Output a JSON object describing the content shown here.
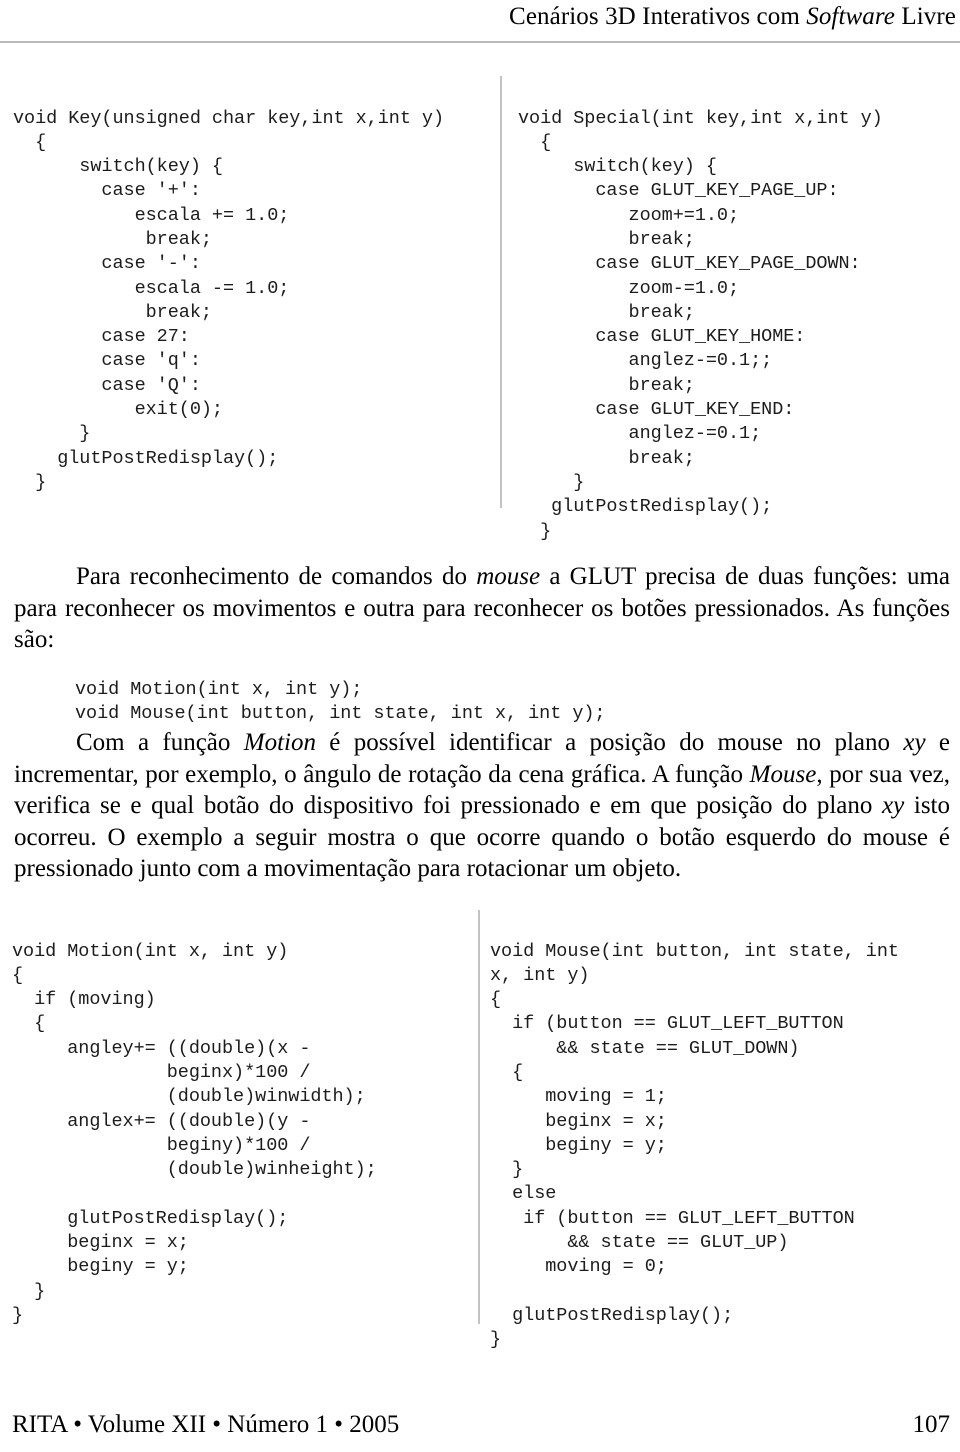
{
  "header": {
    "title_part1": "Cenários 3D Interativos com ",
    "title_italic": "Software",
    "title_part2": " Livre"
  },
  "code_block_key": "void Key(unsigned char key,int x,int y)\n  {\n      switch(key) {\n        case '+':\n           escala += 1.0;\n            break;\n        case '-':\n           escala -= 1.0;\n            break;\n        case 27:\n        case 'q':\n        case 'Q':\n           exit(0);\n      }\n    glutPostRedisplay();\n  }",
  "code_block_special": "void Special(int key,int x,int y)\n  {\n     switch(key) {\n       case GLUT_KEY_PAGE_UP:\n          zoom+=1.0;\n          break;\n       case GLUT_KEY_PAGE_DOWN:\n          zoom-=1.0;\n          break;\n       case GLUT_KEY_HOME:\n          anglez-=0.1;;\n          break;\n       case GLUT_KEY_END:\n          anglez-=0.1;\n          break;\n     }\n   glutPostRedisplay();\n  }",
  "paragraph_1": {
    "run1": "Para reconhecimento de comandos do ",
    "italic1": "mouse",
    "run2": " a GLUT precisa de duas funções: uma para reconhecer os movimentos e outra para reconhecer os botões pressionados. As funções são:"
  },
  "code_prototypes": "void Motion(int x, int y);\nvoid Mouse(int button, int state, int x, int y);",
  "paragraph_2": {
    "run1": "Com a função ",
    "italic1": "Motion",
    "run2": " é possível identificar a posição do mouse no plano ",
    "italic2": "xy",
    "run3": " e incrementar, por exemplo, o ângulo de rotação da cena gráfica. A função ",
    "italic3": "Mouse",
    "run4": ", por sua vez, verifica se e qual botão do dispositivo foi pressionado e em que posição do plano ",
    "italic4": "xy",
    "run5": " isto ocorreu. O exemplo a seguir mostra o que ocorre quando o botão esquerdo do mouse é pressionado junto com a movimentação para rotacionar um objeto."
  },
  "code_block_motion": "void Motion(int x, int y)\n{\n  if (moving)\n  {\n     angley+= ((double)(x -\n              beginx)*100 /\n              (double)winwidth);\n     anglex+= ((double)(y -\n              beginy)*100 /\n              (double)winheight);\n\n     glutPostRedisplay();\n     beginx = x;\n     beginy = y;\n  }\n}",
  "code_block_mouse": "void Mouse(int button, int state, int\nx, int y)\n{\n  if (button == GLUT_LEFT_BUTTON\n      && state == GLUT_DOWN)\n  {\n     moving = 1;\n     beginx = x;\n     beginy = y;\n  }\n  else\n   if (button == GLUT_LEFT_BUTTON\n       && state == GLUT_UP)\n     moving = 0;\n\n  glutPostRedisplay();\n}",
  "footer": {
    "left": "RITA • Volume XII • Número 1 • 2005",
    "page_number": "107"
  }
}
